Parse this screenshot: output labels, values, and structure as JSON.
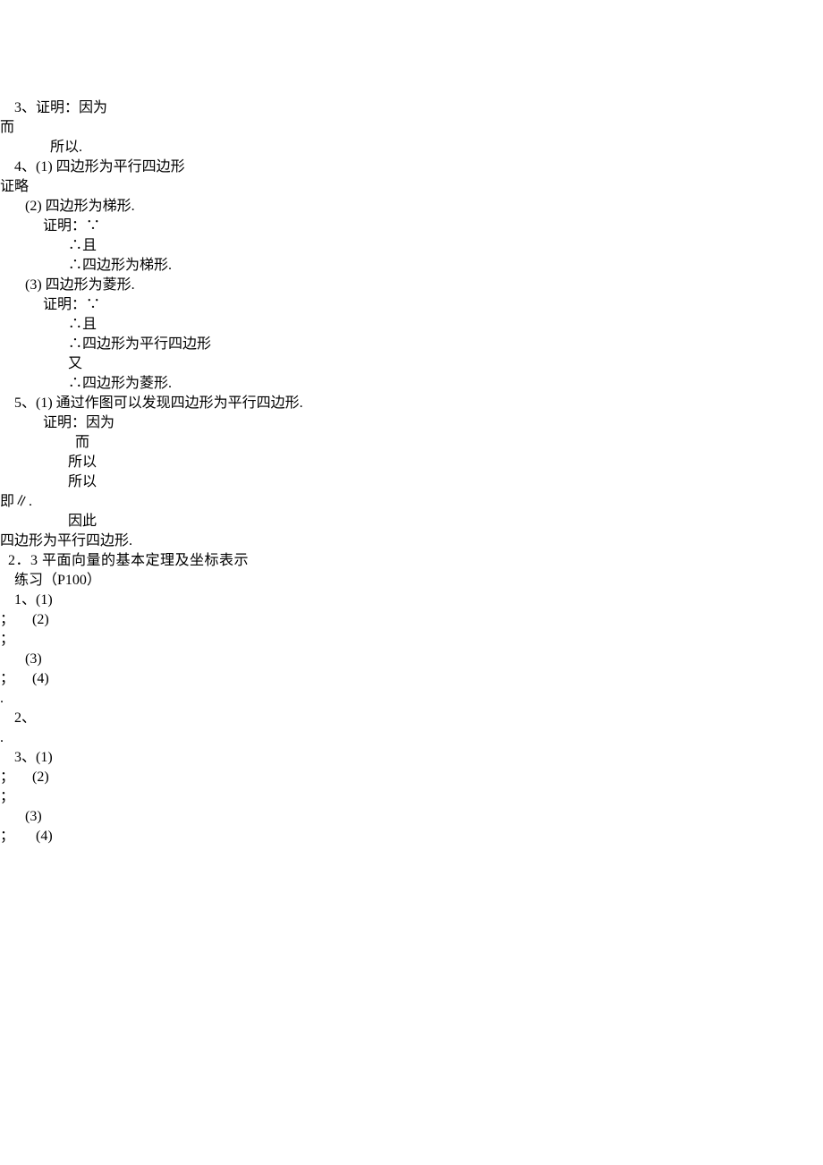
{
  "lines": {
    "l1": "    3、证明：因为",
    "l2": "而",
    "l3": "",
    "l4": "              所以.",
    "l5": "    4、(1) 四边形为平行四边形",
    "l6": "证略",
    "l7": "       (2) 四边形为梯形.",
    "l8": "            证明：∵",
    "l9": "",
    "l10": "                   ∴且",
    "l11": "                   ∴四边形为梯形.",
    "l12": "       (3) 四边形为菱形.",
    "l13": "            证明：∵",
    "l14": "",
    "l15": "                   ∴且",
    "l16": "                   ∴四边形为平行四边形",
    "l17": "                   又",
    "l18": "                   ∴四边形为菱形.",
    "l19": "    5、(1) 通过作图可以发现四边形为平行四边形.",
    "l20": "            证明：因为",
    "l21": "",
    "l22": "                     而",
    "l23": "                   所以",
    "l24": "                   所以",
    "l25": "即∥.",
    "l26": "                   因此",
    "l27": "四边形为平行四边形.",
    "l28": "  2．3 平面向量的基本定理及坐标表示",
    "l29": "    练习（P100）",
    "l30": "    1、(1)",
    "l31": "；     (2)",
    "l32": "；",
    "l33": "       (3)",
    "l34": "；     (4)",
    "l35": ".",
    "l36": "    2、",
    "l37": ".",
    "l38": "    3、(1)",
    "l39": "；     (2)",
    "l40": "；",
    "l41": "       (3)",
    "l42": "；      (4)"
  }
}
